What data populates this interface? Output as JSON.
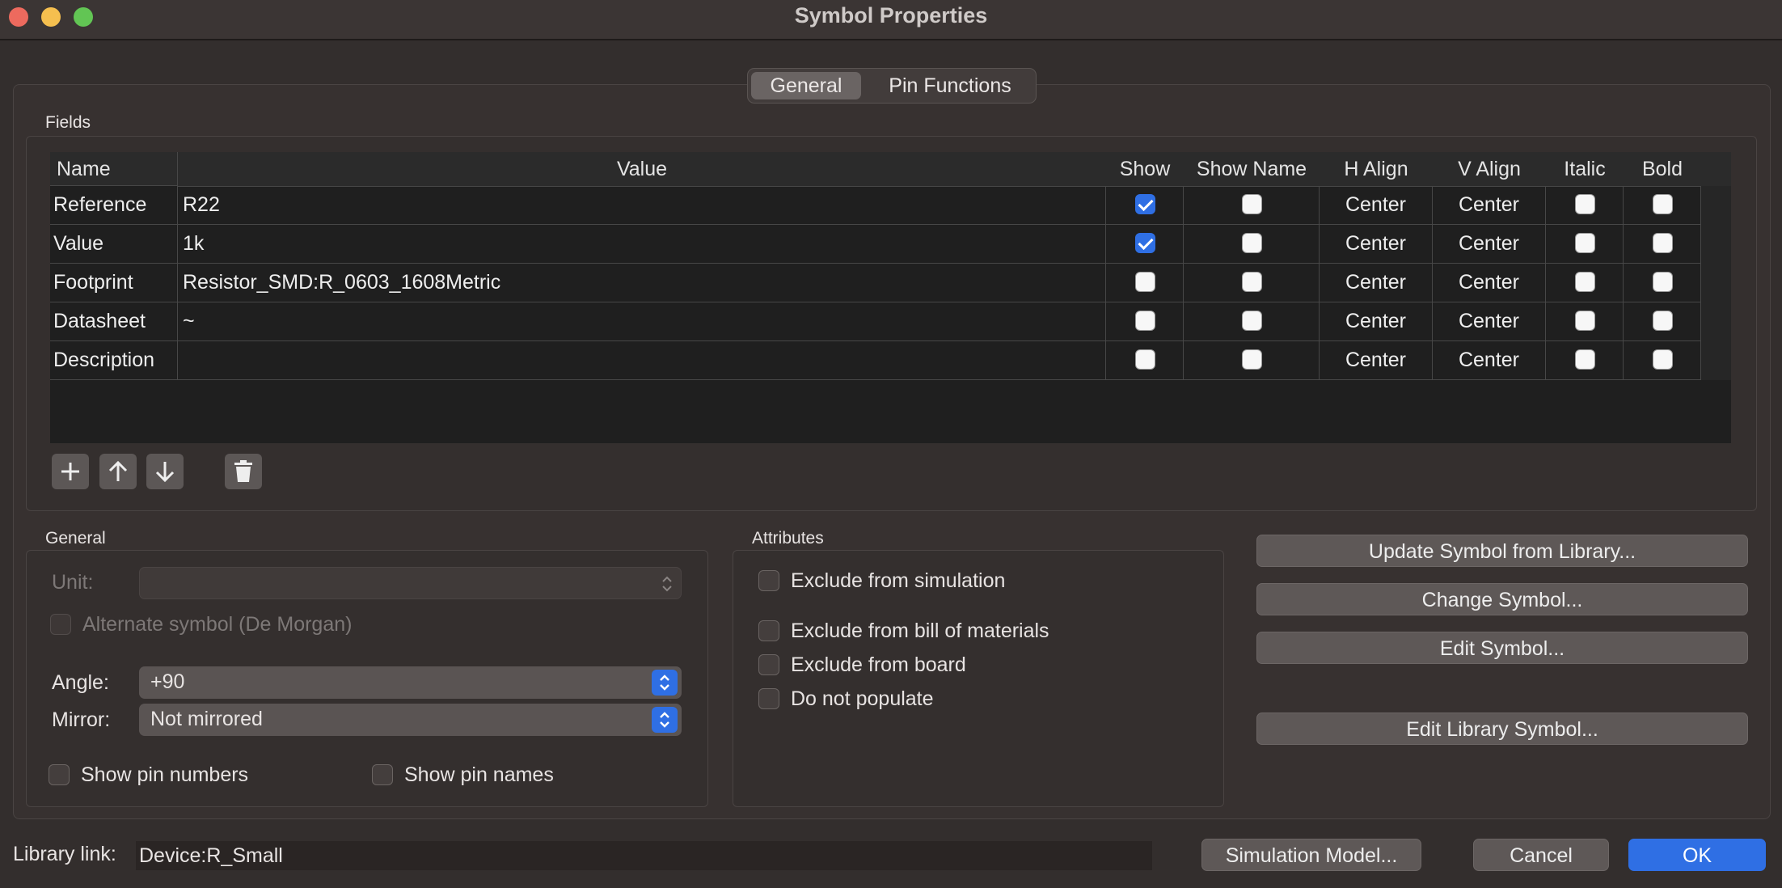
{
  "window": {
    "title": "Symbol Properties"
  },
  "tabs": [
    {
      "label": "General",
      "selected": true
    },
    {
      "label": "Pin Functions",
      "selected": false
    }
  ],
  "fields_group": {
    "label": "Fields",
    "columns": [
      "Name",
      "Value",
      "Show",
      "Show Name",
      "H Align",
      "V Align",
      "Italic",
      "Bold"
    ],
    "rows": [
      {
        "name": "Reference",
        "value": "R22",
        "show": true,
        "show_name": false,
        "h_align": "Center",
        "v_align": "Center",
        "italic": false,
        "bold": false
      },
      {
        "name": "Value",
        "value": "1k",
        "show": true,
        "show_name": false,
        "h_align": "Center",
        "v_align": "Center",
        "italic": false,
        "bold": false
      },
      {
        "name": "Footprint",
        "value": "Resistor_SMD:R_0603_1608Metric",
        "show": false,
        "show_name": false,
        "h_align": "Center",
        "v_align": "Center",
        "italic": false,
        "bold": false
      },
      {
        "name": "Datasheet",
        "value": "~",
        "show": false,
        "show_name": false,
        "h_align": "Center",
        "v_align": "Center",
        "italic": false,
        "bold": false
      },
      {
        "name": "Description",
        "value": "",
        "show": false,
        "show_name": false,
        "h_align": "Center",
        "v_align": "Center",
        "italic": false,
        "bold": false
      }
    ],
    "toolbar_icons": [
      "add-icon",
      "move-up-icon",
      "move-down-icon",
      "delete-icon"
    ]
  },
  "general": {
    "label": "General",
    "unit_label": "Unit:",
    "unit_value": "",
    "alternate_label": "Alternate symbol (De Morgan)",
    "angle_label": "Angle:",
    "angle_value": "+90",
    "mirror_label": "Mirror:",
    "mirror_value": "Not mirrored",
    "show_pin_numbers": "Show pin numbers",
    "show_pin_names": "Show pin names"
  },
  "attributes": {
    "label": "Attributes",
    "items": [
      "Exclude from simulation",
      "Exclude from bill of materials",
      "Exclude from board",
      "Do not populate"
    ]
  },
  "actions": {
    "update": "Update Symbol from Library...",
    "change": "Change Symbol...",
    "edit": "Edit Symbol...",
    "edit_lib": "Edit Library Symbol..."
  },
  "footer": {
    "library_link_label": "Library link:",
    "library_link_value": "Device:R_Small",
    "simulation_model": "Simulation Model...",
    "cancel": "Cancel",
    "ok": "OK"
  },
  "colors": {
    "accent": "#2f6fe4",
    "window_bg": "#332e2d",
    "grid_bg": "#1f1f1f"
  }
}
